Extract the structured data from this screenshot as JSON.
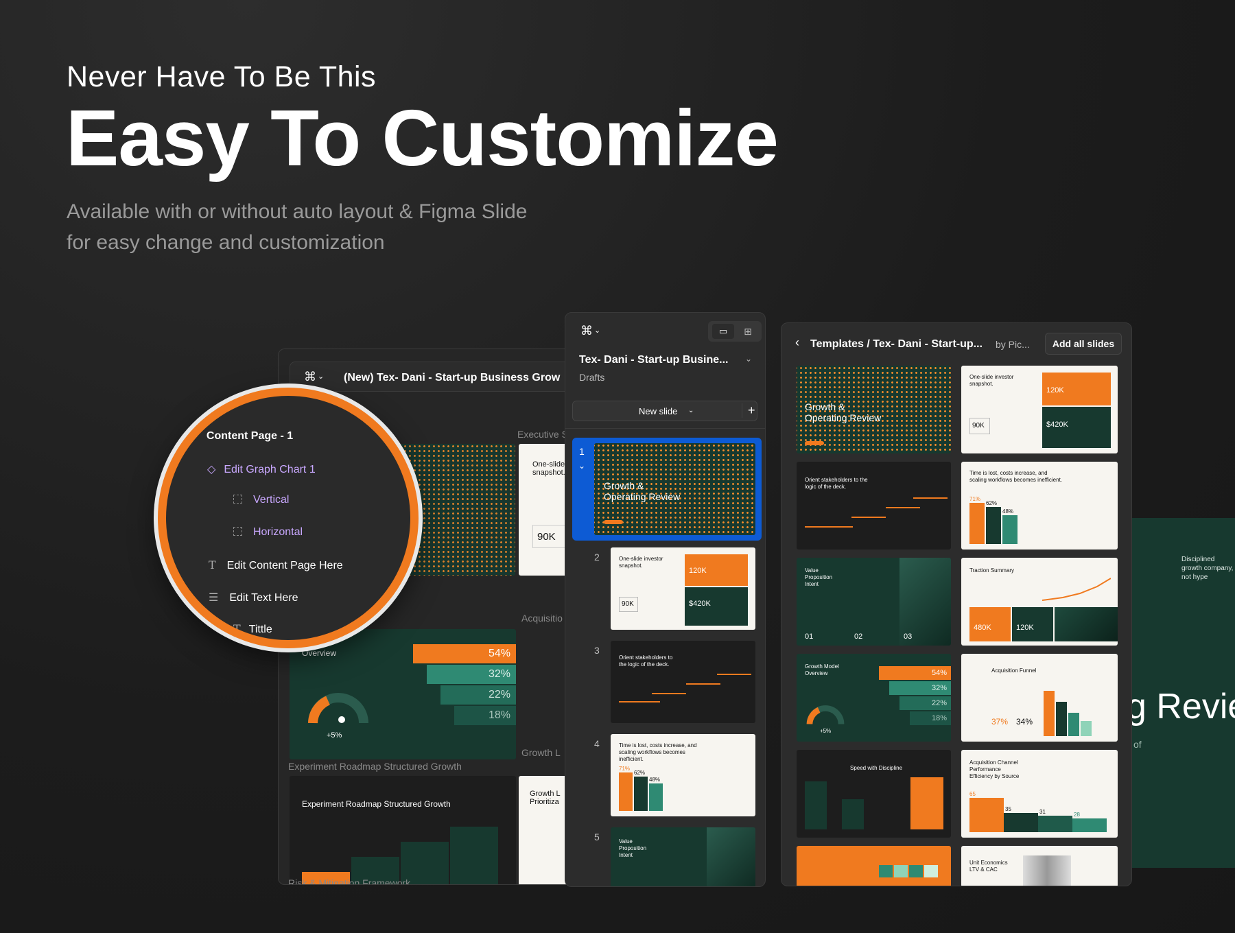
{
  "hero": {
    "kicker": "Never Have To Be This",
    "title": "Easy To Customize",
    "subtitle_line1": "Available with or without auto layout  & Figma Slide",
    "subtitle_line2": "for easy change and customization"
  },
  "back_window": {
    "file_title": "(New) Tex- Dani - Start-up Business Grow",
    "section_labels": [
      "Executive S",
      "Acquisitio",
      "Growth L"
    ],
    "percentages": [
      "54%",
      "32%",
      "22%",
      "18%"
    ],
    "gauge_value": "+5%",
    "big_number": "90K",
    "roadmap_label": "Experiment Roadmap Structured Growth",
    "roadmap_title": "Experiment Roadmap Structured Growth",
    "overview_label": "Overview",
    "snapshot_label": "One-slide snapshot.",
    "prior_label": "Growth L Prioritiza",
    "risk_label": "Risk & Mitigation Framework"
  },
  "layer_panel": {
    "items": [
      {
        "label": "Content Page - 1",
        "icon": "frame-icon"
      },
      {
        "label": "Edit Graph Chart 1",
        "icon": "component-icon"
      },
      {
        "label": "Vertical",
        "icon": "frame-dashed-icon"
      },
      {
        "label": "Horizontal",
        "icon": "frame-dashed-icon"
      },
      {
        "label": "Edit Content Page Here",
        "icon": "text-icon"
      },
      {
        "label": "Edit Text Here",
        "icon": "autolayout-icon"
      },
      {
        "label": "Tittle",
        "icon": "text-icon"
      }
    ]
  },
  "slides_panel": {
    "file_name": "Tex- Dani - Start-up Busine...",
    "location": "Drafts",
    "new_slide_label": "New slide",
    "slide_numbers": [
      "1",
      "2",
      "3",
      "4",
      "5"
    ],
    "slide1_title": "Growth &\nOperating Review",
    "slide2_title": "One-slide investor snapshot.",
    "slide2_values": [
      "120K",
      "90K",
      "$420K"
    ],
    "slide3_title": "Orient stakeholders to the logic of the deck.",
    "slide4_title": "Time is lost, costs increase, and scaling workflows becomes inefficient.",
    "slide4_values": [
      "71%",
      "62%",
      "48%"
    ],
    "slide5_title": "Value Proposition Intent"
  },
  "templates_panel": {
    "breadcrumb": "Templates / Tex- Dani - Start-up...",
    "author": "by Pic...",
    "add_all_label": "Add all slides",
    "t_growth": "Growth &\nOperating Review",
    "t_snapshot": "One-slide investor snapshot.",
    "t_snapshot_vals": [
      "120K",
      "90K",
      "$420K"
    ],
    "t_orient": "Orient stakeholders to the logic of the deck.",
    "t_time": "Time is lost, costs increase, and scaling workflows becomes inefficient.",
    "t_time_vals": [
      "71%",
      "62%",
      "48%"
    ],
    "t_value": "Value Proposition Intent",
    "t_value_nums": [
      "01",
      "02",
      "03"
    ],
    "t_traction": "Traction Summary",
    "t_traction_vals": [
      "480K",
      "120K"
    ],
    "t_model": "Growth Model Overview",
    "t_model_vals": [
      "54%",
      "32%",
      "22%",
      "18%"
    ],
    "t_model_gauge": "+5%",
    "t_funnel": "Acquisition Funnel",
    "t_funnel_vals": [
      "37%",
      "34%"
    ],
    "t_speed": "Speed with Discipline",
    "t_channel": "Acquisition Channel Performance Efficiency by Source",
    "t_channel_vals": [
      "65",
      "35",
      "31",
      "28"
    ],
    "t_unit": "Unit Economics LTV & CAC"
  },
  "right_preview": {
    "caption": "Disciplined growth company, not hype",
    "big_text": "g Revie",
    "small_text": "of"
  },
  "colors": {
    "accent": "#f07a1f",
    "deep_green": "#17392f",
    "teal": "#2f8a73",
    "selection_blue": "#0d5bd4"
  }
}
